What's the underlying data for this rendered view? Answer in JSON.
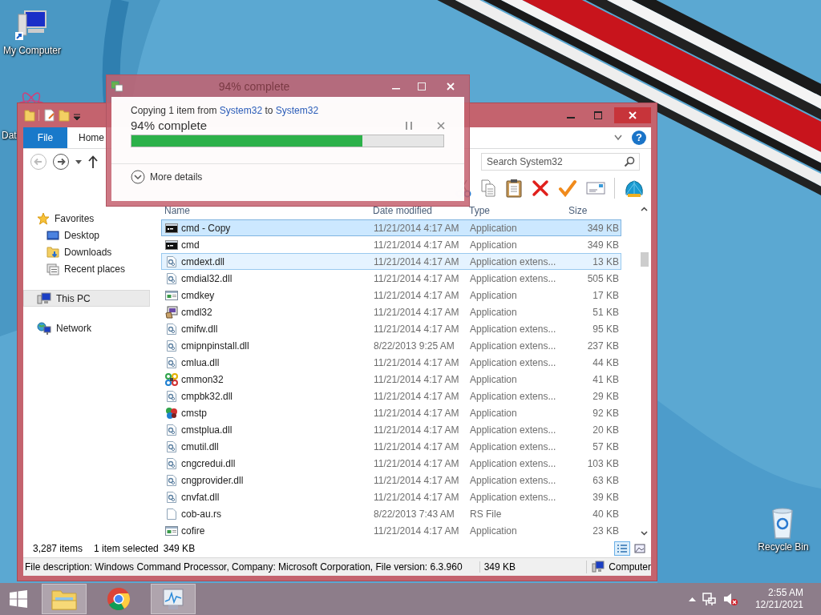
{
  "desktop_icons": [
    {
      "label": "My Computer",
      "kind": "computer"
    },
    {
      "label": "Dat",
      "kind": "atom"
    },
    {
      "label": "Recycle Bin",
      "kind": "recycle"
    }
  ],
  "explorer": {
    "ribbon_tabs": [
      {
        "label": "File",
        "kind": "file"
      },
      {
        "label": "Home",
        "kind": "tab"
      }
    ],
    "help": "?",
    "search": {
      "placeholder": "Search System32"
    },
    "nav": [
      {
        "label": "Favorites",
        "kind": "star",
        "selected": false,
        "children": [
          {
            "label": "Desktop",
            "kind": "desktop",
            "selected": false
          },
          {
            "label": "Downloads",
            "kind": "downloads",
            "selected": false
          },
          {
            "label": "Recent places",
            "kind": "recent",
            "selected": false
          }
        ]
      },
      {
        "label": "This PC",
        "kind": "pc",
        "selected": true
      },
      {
        "label": "Network",
        "kind": "network",
        "selected": false
      }
    ],
    "columns": [
      "Name",
      "Date modified",
      "Type",
      "Size"
    ],
    "rows": [
      {
        "name": "cmd - Copy",
        "date": "11/21/2014 4:17 AM",
        "type": "Application",
        "size": "349 KB",
        "kind": "console",
        "selected": true,
        "hovered": false
      },
      {
        "name": "cmd",
        "date": "11/21/2014 4:17 AM",
        "type": "Application",
        "size": "349 KB",
        "kind": "console",
        "selected": false,
        "hovered": false
      },
      {
        "name": "cmdext.dll",
        "date": "11/21/2014 4:17 AM",
        "type": "Application extens...",
        "size": "13 KB",
        "kind": "dll",
        "selected": false,
        "hovered": true
      },
      {
        "name": "cmdial32.dll",
        "date": "11/21/2014 4:17 AM",
        "type": "Application extens...",
        "size": "505 KB",
        "kind": "dll",
        "selected": false,
        "hovered": false
      },
      {
        "name": "cmdkey",
        "date": "11/21/2014 4:17 AM",
        "type": "Application",
        "size": "17 KB",
        "kind": "app",
        "selected": false,
        "hovered": false
      },
      {
        "name": "cmdl32",
        "date": "11/21/2014 4:17 AM",
        "type": "Application",
        "size": "51 KB",
        "kind": "installer",
        "selected": false,
        "hovered": false
      },
      {
        "name": "cmifw.dll",
        "date": "11/21/2014 4:17 AM",
        "type": "Application extens...",
        "size": "95 KB",
        "kind": "dll",
        "selected": false,
        "hovered": false
      },
      {
        "name": "cmipnpinstall.dll",
        "date": "8/22/2013 9:25 AM",
        "type": "Application extens...",
        "size": "237 KB",
        "kind": "dll",
        "selected": false,
        "hovered": false
      },
      {
        "name": "cmlua.dll",
        "date": "11/21/2014 4:17 AM",
        "type": "Application extens...",
        "size": "44 KB",
        "kind": "dll",
        "selected": false,
        "hovered": false
      },
      {
        "name": "cmmon32",
        "date": "11/21/2014 4:17 AM",
        "type": "Application",
        "size": "41 KB",
        "kind": "knot",
        "selected": false,
        "hovered": false
      },
      {
        "name": "cmpbk32.dll",
        "date": "11/21/2014 4:17 AM",
        "type": "Application extens...",
        "size": "29 KB",
        "kind": "dll",
        "selected": false,
        "hovered": false
      },
      {
        "name": "cmstp",
        "date": "11/21/2014 4:17 AM",
        "type": "Application",
        "size": "92 KB",
        "kind": "knot2",
        "selected": false,
        "hovered": false
      },
      {
        "name": "cmstplua.dll",
        "date": "11/21/2014 4:17 AM",
        "type": "Application extens...",
        "size": "20 KB",
        "kind": "dll",
        "selected": false,
        "hovered": false
      },
      {
        "name": "cmutil.dll",
        "date": "11/21/2014 4:17 AM",
        "type": "Application extens...",
        "size": "57 KB",
        "kind": "dll",
        "selected": false,
        "hovered": false
      },
      {
        "name": "cngcredui.dll",
        "date": "11/21/2014 4:17 AM",
        "type": "Application extens...",
        "size": "103 KB",
        "kind": "dll",
        "selected": false,
        "hovered": false
      },
      {
        "name": "cngprovider.dll",
        "date": "11/21/2014 4:17 AM",
        "type": "Application extens...",
        "size": "63 KB",
        "kind": "dll",
        "selected": false,
        "hovered": false
      },
      {
        "name": "cnvfat.dll",
        "date": "11/21/2014 4:17 AM",
        "type": "Application extens...",
        "size": "39 KB",
        "kind": "dll",
        "selected": false,
        "hovered": false
      },
      {
        "name": "cob-au.rs",
        "date": "8/22/2013 7:43 AM",
        "type": "RS File",
        "size": "40 KB",
        "kind": "file",
        "selected": false,
        "hovered": false
      },
      {
        "name": "cofire",
        "date": "11/21/2014 4:17 AM",
        "type": "Application",
        "size": "23 KB",
        "kind": "app",
        "selected": false,
        "hovered": false
      }
    ],
    "status": {
      "count": "3,287 items",
      "selection": "1 item selected",
      "size": "349 KB"
    },
    "details": {
      "description": "File description: Windows Command Processor, Company: Microsoft Corporation, File version: 6.3.960",
      "size": "349 KB",
      "location": "Computer"
    }
  },
  "copy_dialog": {
    "title": "94% complete",
    "prefix": "Copying 1 item from",
    "source": "System32",
    "middle": "to",
    "target": "System32",
    "progress_text": "94% complete",
    "level": 0.74,
    "more": "More details"
  },
  "taskbar": {
    "apps": [
      {
        "kind": "explorer",
        "active": true
      },
      {
        "kind": "chrome",
        "active": false
      },
      {
        "kind": "monitor",
        "active": true
      }
    ],
    "time": "2:55 AM",
    "date": "12/21/2021"
  }
}
